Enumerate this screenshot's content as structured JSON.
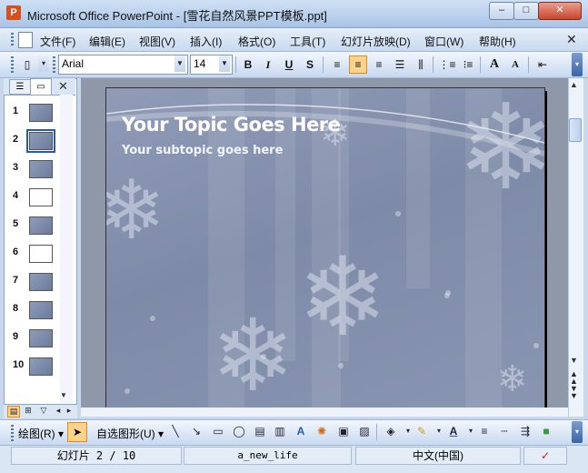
{
  "window": {
    "title": "Microsoft Office PowerPoint - [雪花自然风景PPT模板.ppt]",
    "app_icon": "powerpoint-icon",
    "controls": {
      "minimize": "▭",
      "maximize": "□",
      "close": "✕"
    }
  },
  "menu": {
    "items": [
      "文件(F)",
      "编辑(E)",
      "视图(V)",
      "插入(I)",
      "格式(O)",
      "工具(T)",
      "幻灯片放映(D)",
      "窗口(W)",
      "帮助(H)"
    ],
    "close_glyph": "✕"
  },
  "format_toolbar": {
    "font": "Arial",
    "size": "14",
    "bold": "B",
    "italic": "I",
    "underline": "U",
    "shadow": "S",
    "align_left": "≡",
    "align_center": "≡",
    "align_right": "≡",
    "distribute": "⫼",
    "numbering": "⋮≡",
    "bullets": "⁝≡",
    "font_grow": "A",
    "font_shrink": "A",
    "decrease_indent": "⇤"
  },
  "slide_pane": {
    "close_glyph": "✕",
    "slides": [
      {
        "num": "1",
        "style": "dark",
        "selected": false
      },
      {
        "num": "2",
        "style": "dark",
        "selected": true
      },
      {
        "num": "3",
        "style": "dark",
        "selected": false
      },
      {
        "num": "4",
        "style": "white",
        "selected": false
      },
      {
        "num": "5",
        "style": "dark",
        "selected": false
      },
      {
        "num": "6",
        "style": "white",
        "selected": false
      },
      {
        "num": "7",
        "style": "dark",
        "selected": false
      },
      {
        "num": "8",
        "style": "dark",
        "selected": false
      },
      {
        "num": "9",
        "style": "dark",
        "selected": false
      },
      {
        "num": "10",
        "style": "dark",
        "selected": false
      }
    ]
  },
  "slide": {
    "title": "Your Topic Goes Here",
    "subtitle": "Your subtopic goes here"
  },
  "draw_toolbar": {
    "draw_menu": "绘图(R) ▾",
    "autoshapes_menu": "自选图形(U) ▾"
  },
  "status_bar": {
    "slide_position": "幻灯片 2 / 10",
    "design": "a_new_life",
    "language": "中文(中国)"
  },
  "colors": {
    "accent": "#2c5aa8",
    "toolbar_active": "#ffd38c",
    "slide_bg": "#8591ad"
  }
}
